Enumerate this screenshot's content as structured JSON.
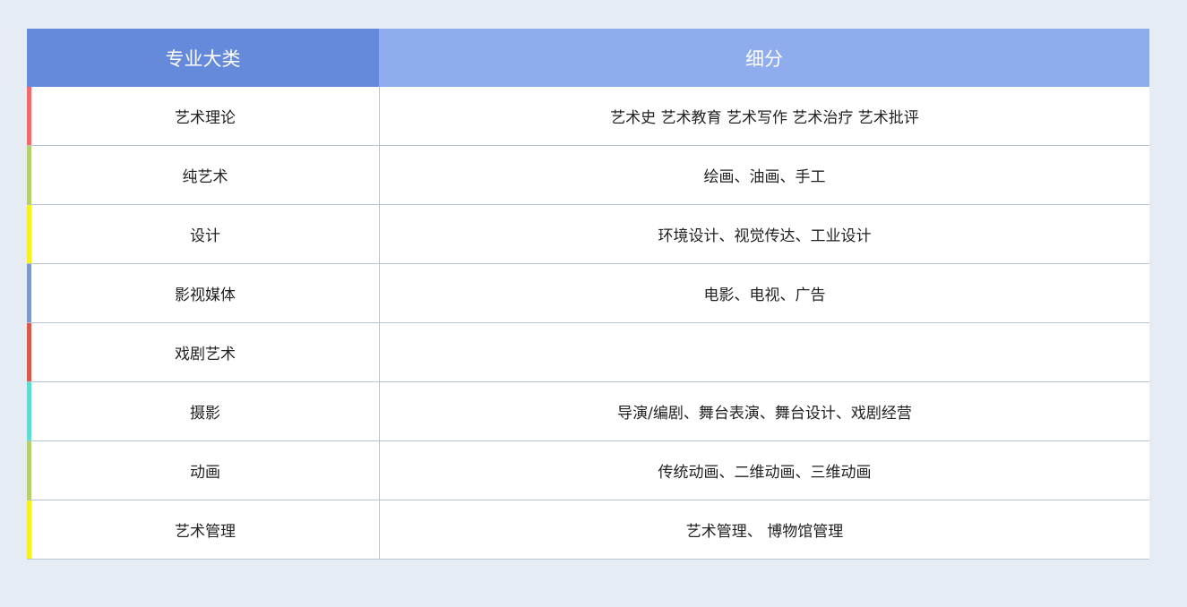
{
  "header": {
    "major_label": "专业大类",
    "sub_label": "细分"
  },
  "rows": [
    {
      "major": "艺术理论",
      "sub": "艺术史 艺术教育 艺术写作 艺术治疗 艺术批评",
      "accent": "#f06a6c"
    },
    {
      "major": "纯艺术",
      "sub": "绘画、油画、手工",
      "accent": "#b5d16c"
    },
    {
      "major": "设计",
      "sub": "环境设计、视觉传达、工业设计",
      "accent": "#f7f21c"
    },
    {
      "major": "影视媒体",
      "sub": "电影、电视、广告",
      "accent": "#8098cf"
    },
    {
      "major": "戏剧艺术",
      "sub": "",
      "accent": "#d95a4c"
    },
    {
      "major": "摄影",
      "sub": "导演/编剧、舞台表演、舞台设计、戏剧经营",
      "accent": "#5fdcd0"
    },
    {
      "major": "动画",
      "sub": "传统动画、二维动画、三维动画",
      "accent": "#b5d16c"
    },
    {
      "major": "艺术管理",
      "sub": "艺术管理、 博物馆管理",
      "accent": "#f7f21c"
    }
  ],
  "colors": {
    "header_major_bg": "#6589db",
    "header_sub_bg": "#8faced",
    "page_bg": "#e5ecf4",
    "row_border": "#b6c4d3"
  }
}
